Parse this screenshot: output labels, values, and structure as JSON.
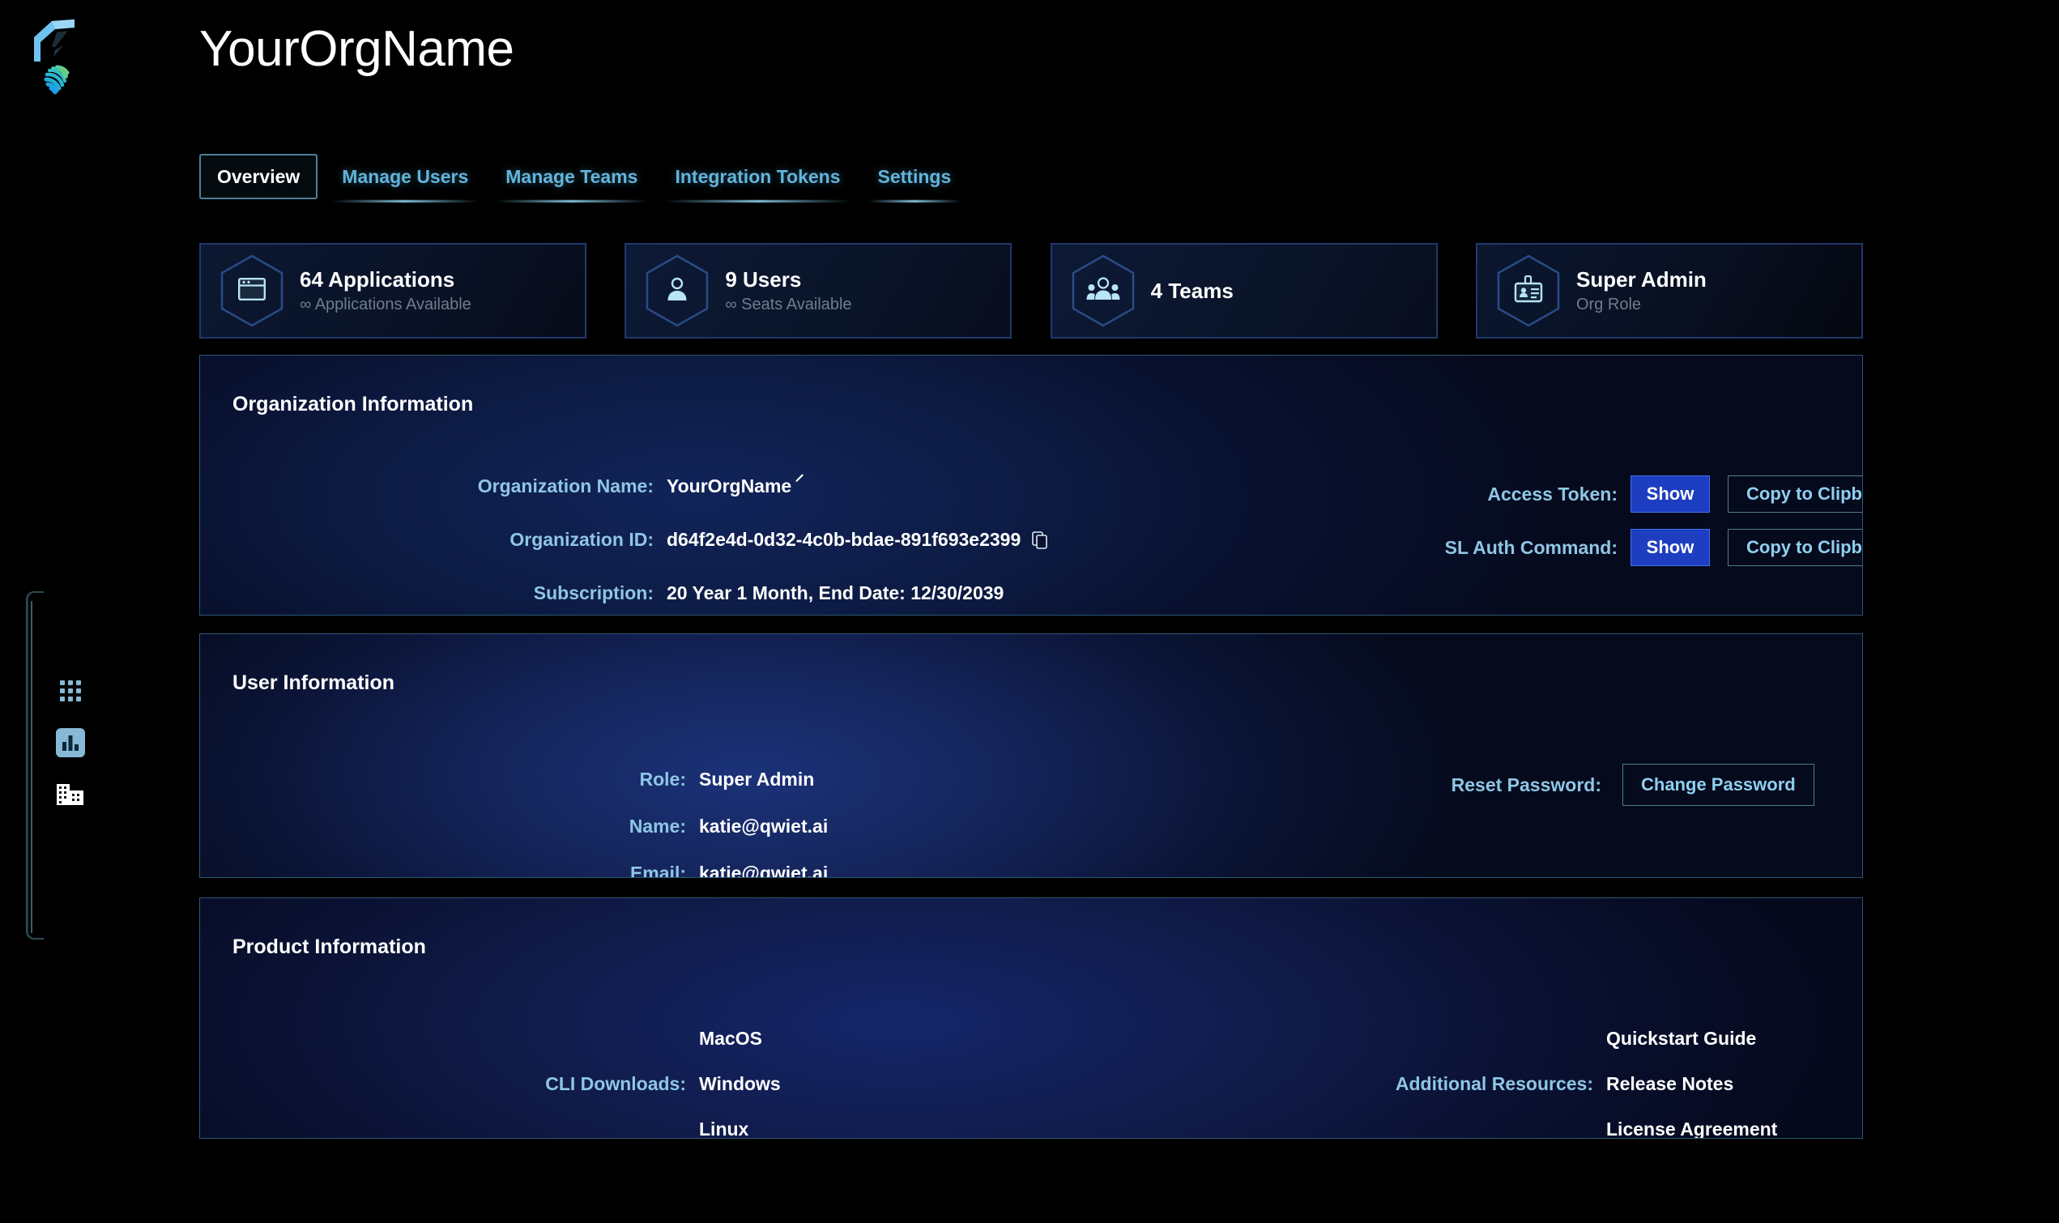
{
  "brand": {
    "logo_name": "qwiet-ai-logo"
  },
  "sidebar": {
    "items": [
      {
        "icon": "grid-apps-icon",
        "name": "applications"
      },
      {
        "icon": "bar-chart-icon",
        "name": "dashboard"
      },
      {
        "icon": "organization-building-icon",
        "name": "organization"
      }
    ]
  },
  "header": {
    "title": "YourOrgName"
  },
  "tabs": [
    {
      "label": "Overview",
      "active": true
    },
    {
      "label": "Manage Users",
      "active": false
    },
    {
      "label": "Manage Teams",
      "active": false
    },
    {
      "label": "Integration Tokens",
      "active": false
    },
    {
      "label": "Settings",
      "active": false
    }
  ],
  "stat_cards": [
    {
      "icon": "application-window-icon",
      "value": "64 Applications",
      "sub": "∞ Applications Available"
    },
    {
      "icon": "user-icon",
      "value": "9 Users",
      "sub": "∞ Seats Available"
    },
    {
      "icon": "team-group-icon",
      "value": "4 Teams",
      "sub": ""
    },
    {
      "icon": "id-badge-icon",
      "value": "Super Admin",
      "sub": "Org Role"
    }
  ],
  "org_info": {
    "title": "Organization Information",
    "org_name_label": "Organization Name:",
    "org_name_value": "YourOrgName",
    "org_id_label": "Organization ID:",
    "org_id_value": "d64f2e4d-0d32-4c0b-bdae-891f693e2399",
    "subscription_label": "Subscription:",
    "subscription_value": "20 Year 1 Month, End Date: 12/30/2039",
    "access_token_label": "Access Token:",
    "sl_auth_label": "SL Auth Command:",
    "show_label": "Show",
    "copy_label": "Copy to Clipboard"
  },
  "user_info": {
    "title": "User Information",
    "role_label": "Role:",
    "role_value": "Super Admin",
    "name_label": "Name:",
    "name_value": "katie@qwiet.ai",
    "email_label": "Email:",
    "email_value": "katie@qwiet.ai",
    "reset_password_label": "Reset Password:",
    "change_password_label": "Change Password"
  },
  "product_info": {
    "title": "Product Information",
    "cli_label": "CLI Downloads:",
    "cli_links": [
      "MacOS",
      "Windows",
      "Linux"
    ],
    "resources_label": "Additional Resources:",
    "resource_links": [
      "Quickstart Guide",
      "Release Notes",
      "License Agreement"
    ]
  },
  "colors": {
    "accent_blue": "#1d3ec0",
    "link_blue": "#8fd0f0",
    "label_blue": "#8fc6e4",
    "tab_blue": "#63b4da",
    "background": "#000000"
  }
}
